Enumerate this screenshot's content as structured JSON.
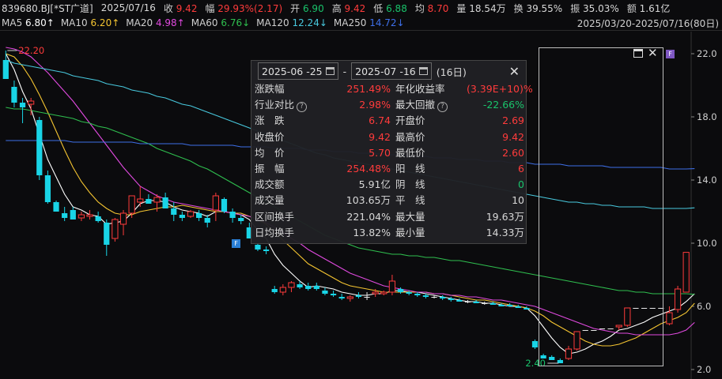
{
  "header": {
    "code": "839680.BJ[*ST广道]",
    "date": "2025/07/16",
    "close_label": "收",
    "close": "9.42",
    "change_label": "幅",
    "change": "29.93%(2.17)",
    "open_label": "开",
    "open": "6.90",
    "high_label": "高",
    "high": "9.42",
    "low_label": "低",
    "low": "6.88",
    "avg_label": "均",
    "avg": "8.70",
    "volume_label": "量",
    "volume": "18.54万",
    "turnover_label": "换",
    "turnover": "39.55%",
    "amplitude_label": "振",
    "amplitude": "35.03%",
    "amount_label": "额",
    "amount": "1.61亿"
  },
  "ma_legend": [
    {
      "name": "MA5",
      "value": "6.80↑",
      "color": "#ffffff"
    },
    {
      "name": "MA10",
      "value": "6.20↑",
      "color": "#f5c531"
    },
    {
      "name": "MA20",
      "value": "4.98↑",
      "color": "#e04adf"
    },
    {
      "name": "MA60",
      "value": "6.76↓",
      "color": "#2fbf4f"
    },
    {
      "name": "MA120",
      "value": "12.24↓",
      "color": "#48c9de"
    },
    {
      "name": "MA250",
      "value": "14.72↓",
      "color": "#3e6fe8"
    }
  ],
  "range_label": "2025/03/20-2025/07/16(80日)",
  "panel": {
    "start_date": "2025-06 -25",
    "end_date": "2025-07 -16",
    "dash": "-",
    "days": "(16日)",
    "rows": [
      {
        "k1": "涨跌幅",
        "v1": "251.49%",
        "c1": "up",
        "k2": "年化收益率",
        "v2": "(3.39E+10)%",
        "c2": "up"
      },
      {
        "k1": "行业对比",
        "q1": true,
        "v1": "2.98%",
        "c1": "up",
        "k2": "最大回撤",
        "q2": true,
        "v2": "-22.66%",
        "c2": "dn"
      },
      {
        "k1": "涨　跌",
        "v1": "6.74",
        "c1": "up",
        "k2": "开盘价",
        "v2": "2.69",
        "c2": "up"
      },
      {
        "k1": "收盘价",
        "v1": "9.42",
        "c1": "up",
        "k2": "最高价",
        "v2": "9.42",
        "c2": "up"
      },
      {
        "k1": "均　价",
        "v1": "5.70",
        "c1": "up",
        "k2": "最低价",
        "v2": "2.60",
        "c2": "up"
      },
      {
        "k1": "振　幅",
        "v1": "254.48%",
        "c1": "up",
        "k2": "阳　线",
        "v2": "6",
        "c2": "up"
      },
      {
        "k1": "成交额",
        "v1": "5.91亿",
        "c1": "",
        "k2": "阴　线",
        "v2": "0",
        "c2": "dn"
      },
      {
        "k1": "成交量",
        "v1": "103.65万",
        "c1": "",
        "k2": "平　线",
        "v2": "10",
        "c2": ""
      },
      {
        "k1": "区间换手",
        "v1": "221.04%",
        "c1": "",
        "k2": "最大量",
        "v2": "19.63万",
        "c2": ""
      },
      {
        "k1": "日均换手",
        "v1": "13.82%",
        "c1": "",
        "k2": "最小量",
        "v2": "14.33万",
        "c2": ""
      }
    ]
  },
  "badges": {
    "f": "F"
  },
  "chart_data": {
    "type": "candlestick",
    "y_ticks": [
      22.0,
      18.0,
      14.0,
      10.0,
      6.0,
      2.0
    ],
    "ylim": [
      1.8,
      22.6
    ],
    "annotations": [
      {
        "text": "22.20",
        "kind": "high"
      },
      {
        "text": "2.40",
        "kind": "low"
      }
    ],
    "candles": [
      {
        "o": 21.6,
        "h": 22.2,
        "l": 20.5,
        "c": 20.4
      },
      {
        "o": 19.9,
        "h": 20.3,
        "l": 18.6,
        "c": 18.9
      },
      {
        "o": 18.9,
        "h": 19.2,
        "l": 17.6,
        "c": 18.6
      },
      {
        "o": 18.8,
        "h": 19.2,
        "l": 18.1,
        "c": 19.0
      },
      {
        "o": 17.8,
        "h": 18.0,
        "l": 14.0,
        "c": 14.3
      },
      {
        "o": 14.3,
        "h": 14.6,
        "l": 12.5,
        "c": 12.6
      },
      {
        "o": 12.6,
        "h": 12.7,
        "l": 12.1,
        "c": 12.0
      },
      {
        "o": 11.9,
        "h": 12.3,
        "l": 11.4,
        "c": 11.6
      },
      {
        "o": 12.1,
        "h": 12.3,
        "l": 11.5,
        "c": 11.5
      },
      {
        "o": 11.6,
        "h": 12.0,
        "l": 11.4,
        "c": 11.8
      },
      {
        "o": 11.7,
        "h": 12.1,
        "l": 11.5,
        "c": 11.8
      },
      {
        "o": 11.7,
        "h": 12.0,
        "l": 11.3,
        "c": 11.4
      },
      {
        "o": 11.3,
        "h": 11.5,
        "l": 9.2,
        "c": 9.9
      },
      {
        "o": 10.3,
        "h": 11.6,
        "l": 10.1,
        "c": 11.5
      },
      {
        "o": 11.2,
        "h": 12.1,
        "l": 10.5,
        "c": 11.9
      },
      {
        "o": 11.9,
        "h": 13.0,
        "l": 11.6,
        "c": 13.0
      },
      {
        "o": 12.6,
        "h": 13.6,
        "l": 12.3,
        "c": 12.8
      },
      {
        "o": 12.8,
        "h": 13.1,
        "l": 12.6,
        "c": 12.5
      },
      {
        "o": 12.6,
        "h": 13.1,
        "l": 12.0,
        "c": 12.9
      },
      {
        "o": 12.9,
        "h": 13.2,
        "l": 12.5,
        "c": 12.2
      },
      {
        "o": 12.2,
        "h": 12.6,
        "l": 11.4,
        "c": 11.8
      },
      {
        "o": 11.8,
        "h": 12.0,
        "l": 11.4,
        "c": 11.6
      },
      {
        "o": 11.7,
        "h": 12.1,
        "l": 11.6,
        "c": 12.0
      },
      {
        "o": 11.9,
        "h": 12.1,
        "l": 11.4,
        "c": 11.6
      },
      {
        "o": 11.6,
        "h": 11.8,
        "l": 11.0,
        "c": 11.3
      },
      {
        "o": 12.1,
        "h": 13.2,
        "l": 11.4,
        "c": 13.0
      },
      {
        "o": 12.8,
        "h": 12.9,
        "l": 11.9,
        "c": 12.0
      },
      {
        "o": 12.0,
        "h": 12.2,
        "l": 11.3,
        "c": 11.6
      },
      {
        "o": 11.6,
        "h": 11.8,
        "l": 11.2,
        "c": 11.4
      },
      {
        "o": 11.0,
        "h": 11.3,
        "l": 10.3,
        "c": 10.3
      },
      {
        "o": 9.9,
        "h": 10.0,
        "l": 9.5,
        "c": 9.6
      },
      {
        "o": 9.6,
        "h": 9.8,
        "l": 9.3,
        "c": 9.5
      },
      {
        "o": 7.1,
        "h": 7.3,
        "l": 6.8,
        "c": 6.9
      },
      {
        "o": 6.9,
        "h": 7.4,
        "l": 6.7,
        "c": 7.2
      },
      {
        "o": 7.2,
        "h": 7.6,
        "l": 6.9,
        "c": 7.5
      },
      {
        "o": 7.4,
        "h": 7.6,
        "l": 7.1,
        "c": 7.2
      },
      {
        "o": 7.3,
        "h": 7.5,
        "l": 7.0,
        "c": 7.1
      },
      {
        "o": 7.3,
        "h": 7.5,
        "l": 7.0,
        "c": 7.1
      },
      {
        "o": 7.0,
        "h": 7.2,
        "l": 6.7,
        "c": 6.8
      },
      {
        "o": 6.8,
        "h": 7.0,
        "l": 6.6,
        "c": 6.7
      },
      {
        "o": 6.6,
        "h": 6.8,
        "l": 6.4,
        "c": 6.5
      },
      {
        "o": 6.5,
        "h": 6.7,
        "l": 6.3,
        "c": 6.6
      },
      {
        "o": 6.7,
        "h": 6.9,
        "l": 6.5,
        "c": 6.6
      },
      {
        "o": 6.6,
        "h": 6.9,
        "l": 6.4,
        "c": 6.6
      },
      {
        "o": 6.8,
        "h": 7.1,
        "l": 6.6,
        "c": 6.9
      },
      {
        "o": 6.8,
        "h": 7.0,
        "l": 6.7,
        "c": 6.9
      },
      {
        "o": 6.9,
        "h": 8.0,
        "l": 6.7,
        "c": 7.6
      },
      {
        "o": 7.1,
        "h": 7.2,
        "l": 6.8,
        "c": 6.9
      },
      {
        "o": 6.9,
        "h": 7.0,
        "l": 6.7,
        "c": 6.8
      },
      {
        "o": 6.8,
        "h": 6.9,
        "l": 6.6,
        "c": 6.7
      },
      {
        "o": 6.7,
        "h": 6.8,
        "l": 6.5,
        "c": 6.6
      },
      {
        "o": 6.6,
        "h": 6.7,
        "l": 6.5,
        "c": 6.6
      },
      {
        "o": 6.6,
        "h": 6.7,
        "l": 6.4,
        "c": 6.5
      },
      {
        "o": 6.5,
        "h": 6.6,
        "l": 6.3,
        "c": 6.4
      },
      {
        "o": 6.4,
        "h": 6.5,
        "l": 6.3,
        "c": 6.3
      },
      {
        "o": 6.3,
        "h": 6.4,
        "l": 6.2,
        "c": 6.3
      },
      {
        "o": 6.3,
        "h": 6.4,
        "l": 6.2,
        "c": 6.2
      },
      {
        "o": 6.2,
        "h": 6.3,
        "l": 6.1,
        "c": 6.2
      },
      {
        "o": 6.2,
        "h": 6.3,
        "l": 6.1,
        "c": 6.1
      },
      {
        "o": 6.1,
        "h": 6.2,
        "l": 6.0,
        "c": 6.0
      },
      {
        "o": 6.1,
        "h": 6.2,
        "l": 6.0,
        "c": 6.0
      },
      {
        "o": 6.0,
        "h": 6.1,
        "l": 5.9,
        "c": 5.9
      },
      {
        "o": 5.9,
        "h": 6.0,
        "l": 5.8,
        "c": 5.8
      },
      {
        "o": 3.8,
        "h": 3.9,
        "l": 3.3,
        "c": 3.4
      },
      {
        "o": 2.9,
        "h": 3.0,
        "l": 2.7,
        "c": 2.7
      },
      {
        "o": 2.8,
        "h": 2.9,
        "l": 2.6,
        "c": 2.6
      },
      {
        "o": 2.6,
        "h": 2.7,
        "l": 2.4,
        "c": 2.4
      },
      {
        "o": 2.7,
        "h": 3.5,
        "l": 2.6,
        "c": 3.3
      },
      {
        "o": 3.3,
        "h": 4.4,
        "l": 3.2,
        "c": 4.4
      },
      {
        "o": 4.5,
        "h": 4.5,
        "l": 4.5,
        "c": 4.5
      },
      {
        "o": 4.5,
        "h": 4.5,
        "l": 4.5,
        "c": 4.5
      },
      {
        "o": 4.6,
        "h": 4.6,
        "l": 4.6,
        "c": 4.6
      },
      {
        "o": 4.6,
        "h": 4.6,
        "l": 4.6,
        "c": 4.6
      },
      {
        "o": 4.7,
        "h": 4.8,
        "l": 4.5,
        "c": 4.8
      },
      {
        "o": 4.8,
        "h": 5.9,
        "l": 4.7,
        "c": 5.9
      },
      {
        "o": 5.9,
        "h": 5.9,
        "l": 5.9,
        "c": 5.9
      },
      {
        "o": 5.9,
        "h": 5.9,
        "l": 5.9,
        "c": 5.9
      },
      {
        "o": 5.9,
        "h": 5.9,
        "l": 5.9,
        "c": 5.9
      },
      {
        "o": 5.9,
        "h": 5.9,
        "l": 5.9,
        "c": 5.9
      },
      {
        "o": 4.9,
        "h": 6.0,
        "l": 4.8,
        "c": 5.6
      },
      {
        "o": 5.8,
        "h": 7.3,
        "l": 5.6,
        "c": 7.1
      },
      {
        "o": 6.9,
        "h": 9.42,
        "l": 6.88,
        "c": 9.42
      }
    ],
    "ma": {
      "MA5": [
        22.0,
        21.0,
        19.6,
        18.5,
        16.9,
        15.3,
        14.2,
        13.1,
        12.3,
        12.1,
        11.8,
        11.7,
        11.2,
        11.3,
        11.4,
        11.9,
        12.5,
        12.7,
        12.7,
        12.6,
        12.3,
        12.1,
        12.0,
        11.9,
        11.7,
        12.0,
        12.0,
        11.9,
        11.8,
        11.5,
        10.8,
        10.3,
        9.3,
        8.6,
        8.1,
        7.6,
        7.2,
        7.3,
        7.2,
        7.1,
        6.9,
        6.8,
        6.7,
        6.7,
        6.8,
        6.8,
        7.0,
        7.0,
        6.9,
        6.9,
        6.8,
        6.7,
        6.6,
        6.5,
        6.4,
        6.3,
        6.3,
        6.2,
        6.2,
        6.1,
        6.0,
        6.0,
        5.9,
        5.4,
        4.7,
        4.0,
        3.4,
        3.0,
        3.1,
        3.3,
        3.6,
        3.8,
        4.1,
        4.5,
        4.6,
        4.8,
        5.0,
        5.3,
        5.5,
        5.7,
        5.9,
        6.3,
        6.8
      ],
      "MA10": [
        22.0,
        21.8,
        21.2,
        20.4,
        19.4,
        18.3,
        17.1,
        15.9,
        14.8,
        13.9,
        13.2,
        12.6,
        12.2,
        11.9,
        11.8,
        11.8,
        12.0,
        12.1,
        12.2,
        12.3,
        12.3,
        12.4,
        12.3,
        12.2,
        12.1,
        12.0,
        12.0,
        11.9,
        11.9,
        11.7,
        11.5,
        11.2,
        10.7,
        10.2,
        9.7,
        9.2,
        8.7,
        8.4,
        8.1,
        7.8,
        7.5,
        7.3,
        7.2,
        7.1,
        7.0,
        6.9,
        6.9,
        6.9,
        6.9,
        6.9,
        6.9,
        6.8,
        6.8,
        6.7,
        6.6,
        6.5,
        6.4,
        6.4,
        6.3,
        6.2,
        6.1,
        6.0,
        5.9,
        5.7,
        5.4,
        5.0,
        4.7,
        4.4,
        4.1,
        3.8,
        3.6,
        3.5,
        3.5,
        3.6,
        3.8,
        4.0,
        4.3,
        4.6,
        4.9,
        5.1,
        5.3,
        5.6,
        6.2
      ],
      "MA20": [
        22.4,
        22.3,
        22.1,
        21.8,
        21.3,
        20.8,
        20.2,
        19.6,
        19.0,
        18.3,
        17.6,
        16.9,
        16.2,
        15.5,
        14.8,
        14.2,
        13.6,
        13.3,
        13.0,
        12.8,
        12.6,
        12.5,
        12.4,
        12.3,
        12.2,
        12.1,
        12.0,
        11.9,
        11.8,
        11.7,
        11.5,
        11.3,
        11.0,
        10.7,
        10.3,
        10.0,
        9.6,
        9.3,
        9.0,
        8.7,
        8.4,
        8.1,
        7.9,
        7.7,
        7.5,
        7.3,
        7.2,
        7.1,
        7.0,
        6.9,
        6.9,
        6.8,
        6.8,
        6.7,
        6.7,
        6.6,
        6.6,
        6.5,
        6.4,
        6.4,
        6.3,
        6.2,
        6.1,
        6.0,
        5.8,
        5.6,
        5.4,
        5.2,
        5.0,
        4.8,
        4.6,
        4.5,
        4.4,
        4.3,
        4.3,
        4.2,
        4.2,
        4.2,
        4.2,
        4.2,
        4.3,
        4.5,
        4.98
      ],
      "MA60": [
        18.6,
        18.5,
        18.5,
        18.4,
        18.3,
        18.2,
        18.1,
        18.0,
        17.9,
        17.7,
        17.6,
        17.4,
        17.3,
        17.1,
        16.9,
        16.7,
        16.5,
        16.3,
        16.0,
        15.8,
        15.6,
        15.4,
        15.2,
        14.9,
        14.7,
        14.4,
        14.1,
        13.8,
        13.5,
        13.2,
        12.9,
        12.6,
        12.3,
        12.0,
        11.7,
        11.4,
        11.1,
        10.8,
        10.5,
        10.3,
        10.1,
        9.9,
        9.7,
        9.6,
        9.5,
        9.4,
        9.3,
        9.3,
        9.2,
        9.2,
        9.1,
        9.1,
        9.0,
        8.9,
        8.9,
        8.8,
        8.7,
        8.6,
        8.5,
        8.4,
        8.3,
        8.2,
        8.1,
        8.0,
        7.9,
        7.8,
        7.7,
        7.6,
        7.5,
        7.4,
        7.3,
        7.2,
        7.1,
        7.0,
        7.0,
        6.9,
        6.9,
        6.8,
        6.8,
        6.8,
        6.8,
        6.8,
        6.76
      ],
      "MA120": [
        21.6,
        21.4,
        21.3,
        21.2,
        21.1,
        21.0,
        20.9,
        20.8,
        20.6,
        20.5,
        20.4,
        20.3,
        20.1,
        20.0,
        19.9,
        19.7,
        19.6,
        19.5,
        19.3,
        19.2,
        19.0,
        18.8,
        18.7,
        18.5,
        18.3,
        18.1,
        17.9,
        17.7,
        17.5,
        17.3,
        17.1,
        16.9,
        16.7,
        16.5,
        16.3,
        16.1,
        15.9,
        15.7,
        15.6,
        15.4,
        15.3,
        15.2,
        15.1,
        15.0,
        14.9,
        14.8,
        14.7,
        14.6,
        14.5,
        14.4,
        14.3,
        14.2,
        14.1,
        14.0,
        13.9,
        13.8,
        13.7,
        13.6,
        13.5,
        13.4,
        13.3,
        13.2,
        13.1,
        13.0,
        12.9,
        12.8,
        12.7,
        12.6,
        12.6,
        12.5,
        12.5,
        12.4,
        12.4,
        12.3,
        12.3,
        12.3,
        12.3,
        12.2,
        12.2,
        12.2,
        12.2,
        12.2,
        12.24
      ],
      "MA250": [
        16.5,
        16.5,
        16.5,
        16.5,
        16.5,
        16.5,
        16.5,
        16.5,
        16.4,
        16.4,
        16.4,
        16.4,
        16.4,
        16.4,
        16.4,
        16.4,
        16.3,
        16.3,
        16.3,
        16.3,
        16.3,
        16.3,
        16.2,
        16.2,
        16.2,
        16.2,
        16.2,
        16.2,
        16.1,
        16.1,
        16.1,
        16.1,
        16.0,
        16.0,
        16.0,
        16.0,
        15.9,
        15.9,
        15.9,
        15.8,
        15.8,
        15.8,
        15.7,
        15.7,
        15.7,
        15.6,
        15.6,
        15.6,
        15.5,
        15.5,
        15.5,
        15.4,
        15.4,
        15.4,
        15.3,
        15.3,
        15.3,
        15.2,
        15.2,
        15.2,
        15.1,
        15.1,
        15.1,
        15.0,
        15.0,
        15.0,
        15.0,
        14.9,
        14.9,
        14.9,
        14.9,
        14.9,
        14.8,
        14.8,
        14.8,
        14.8,
        14.8,
        14.8,
        14.8,
        14.7,
        14.7,
        14.7,
        14.72
      ]
    }
  }
}
